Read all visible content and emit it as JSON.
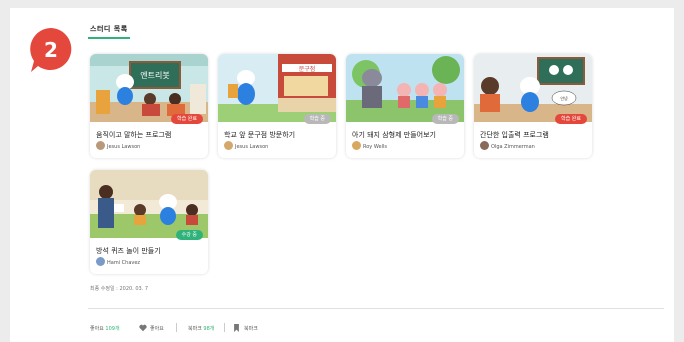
{
  "step_number": "2",
  "section_title": "스터디 목록",
  "cards": [
    {
      "title": "움직이고 말하는 프로그램",
      "author": "Jesus Lawson",
      "badge": "학습 완료",
      "badge_color": "#e4473b",
      "avatar_color": "#b89a7a"
    },
    {
      "title": "학교 앞 문구점 방문하기",
      "author": "Jesus Lawson",
      "badge": "학습 중",
      "badge_color": "#b8b8b8",
      "avatar_color": "#d4a86a"
    },
    {
      "title": "아기 돼지 삼형제 만들어보기",
      "author": "Roy Wells",
      "badge": "학습 중",
      "badge_color": "#b8b8b8",
      "avatar_color": "#d8a860"
    },
    {
      "title": "간단한 입출력 프로그램",
      "author": "Olga Zimmerman",
      "badge": "학습 완료",
      "badge_color": "#e4473b",
      "avatar_color": "#8a6a5a"
    },
    {
      "title": "방석 퀴즈 놀이 만들기",
      "author": "Hami Chavez",
      "badge": "수강 중",
      "badge_color": "#2fb37a",
      "avatar_color": "#7a9ac8"
    }
  ],
  "updated_text": "최종 수정일 : 2020. 03. 7",
  "footer": {
    "likes_label": "좋아요",
    "likes_count": "109개",
    "like_button": "좋아요",
    "bookmarks_label": "북마크",
    "bookmarks_count": "98개",
    "bookmark_button": "북마크"
  },
  "colors": {
    "accent": "#2fb37a",
    "badge": "#e4473b"
  }
}
